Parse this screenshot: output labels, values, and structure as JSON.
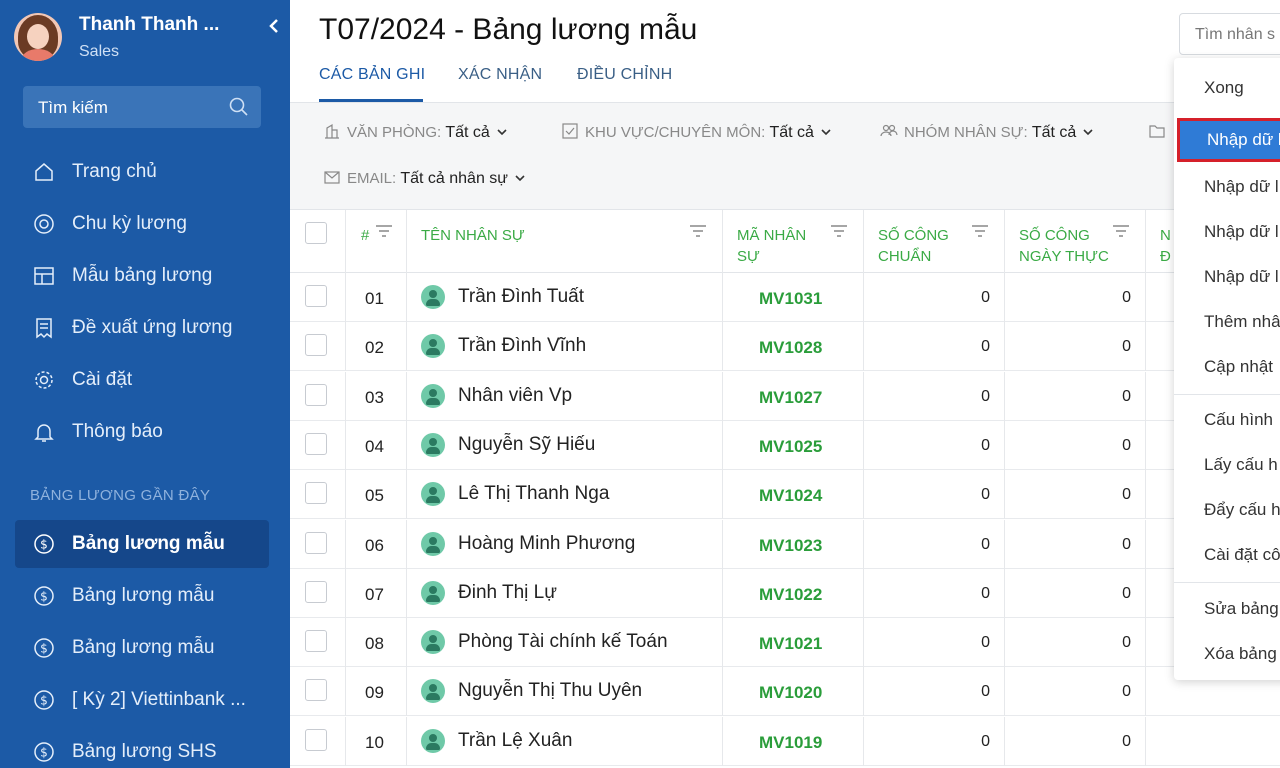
{
  "sidebar": {
    "profile_name": "Thanh Thanh ...",
    "profile_role": "Sales",
    "search_placeholder": "Tìm kiếm",
    "nav": [
      {
        "label": "Trang chủ",
        "icon": "home-icon"
      },
      {
        "label": "Chu kỳ lương",
        "icon": "cycle-icon"
      },
      {
        "label": "Mẫu bảng lương",
        "icon": "template-icon"
      },
      {
        "label": "Đề xuất ứng lương",
        "icon": "request-icon"
      },
      {
        "label": "Cài đặt",
        "icon": "gear-icon"
      },
      {
        "label": "Thông báo",
        "icon": "bell-icon"
      }
    ],
    "recent_title": "BẢNG LƯƠNG GẦN ĐÂY",
    "recent": [
      {
        "label": "Bảng lương mẫu"
      },
      {
        "label": "Bảng lương mẫu"
      },
      {
        "label": "Bảng lương mẫu"
      },
      {
        "label": "[ Kỳ 2] Viettinbank ..."
      },
      {
        "label": "Bảng lương SHS"
      }
    ]
  },
  "header": {
    "title": "T07/2024 - Bảng lương mẫu",
    "tabs": [
      "CÁC BẢN GHI",
      "XÁC NHẬN",
      "ĐIỀU CHỈNH"
    ],
    "search_placeholder": "Tìm nhân s"
  },
  "filters": {
    "office_key": "VĂN PHÒNG:",
    "office_value": "Tất cả",
    "area_key": "KHU VỰC/CHUYÊN MÔN:",
    "area_value": "Tất cả",
    "group_key": "NHÓM NHÂN SỰ:",
    "group_value": "Tất cả",
    "email_key": "EMAIL:",
    "email_value": "Tất cả nhân sự"
  },
  "table": {
    "headers": {
      "index": "#",
      "name": "TÊN NHÂN SỰ",
      "code_line1": "MÃ NHÂN",
      "code_line2": "SỰ",
      "std_line1": "SỐ CÔNG",
      "std_line2": "CHUẨN",
      "act_line1": "SỐ CÔNG",
      "act_line2": "NGÀY THỰC",
      "next_line1": "N",
      "next_line2": "Đ"
    },
    "rows": [
      {
        "index": "01",
        "name": "Trần Đình Tuất",
        "code": "MV1031",
        "std": "0",
        "act": "0"
      },
      {
        "index": "02",
        "name": "Trần Đình Vĩnh",
        "code": "MV1028",
        "std": "0",
        "act": "0"
      },
      {
        "index": "03",
        "name": "Nhân viên Vp",
        "code": "MV1027",
        "std": "0",
        "act": "0"
      },
      {
        "index": "04",
        "name": "Nguyễn Sỹ Hiếu",
        "code": "MV1025",
        "std": "0",
        "act": "0"
      },
      {
        "index": "05",
        "name": "Lê Thị Thanh Nga",
        "code": "MV1024",
        "std": "0",
        "act": "0"
      },
      {
        "index": "06",
        "name": "Hoàng Minh Phương",
        "code": "MV1023",
        "std": "0",
        "act": "0"
      },
      {
        "index": "07",
        "name": "Đinh Thị Lự",
        "code": "MV1022",
        "std": "0",
        "act": "0"
      },
      {
        "index": "08",
        "name": "Phòng Tài chính kế Toán",
        "code": "MV1021",
        "std": "0",
        "act": "0"
      },
      {
        "index": "09",
        "name": "Nguyễn Thị Thu Uyên",
        "code": "MV1020",
        "std": "0",
        "act": "0"
      },
      {
        "index": "10",
        "name": "Trần Lệ Xuân",
        "code": "MV1019",
        "std": "0",
        "act": "0"
      }
    ]
  },
  "menu": {
    "items": [
      "Xong",
      "Nhập dữ l",
      "Nhập dữ l",
      "Nhập dữ l",
      "Nhập dữ l",
      "Thêm nhâ",
      "Cập nhật",
      "Cấu hình",
      "Lấy cấu h",
      "Đẩy cấu h",
      "Cài đặt cô",
      "Sửa bảng",
      "Xóa bảng"
    ]
  },
  "colors": {
    "sidebar": "#1c5aa6",
    "accent": "#1c5aa6",
    "green": "#2a9d3a",
    "highlight": "#2f7bd6",
    "highlight_border": "#d5202a"
  }
}
